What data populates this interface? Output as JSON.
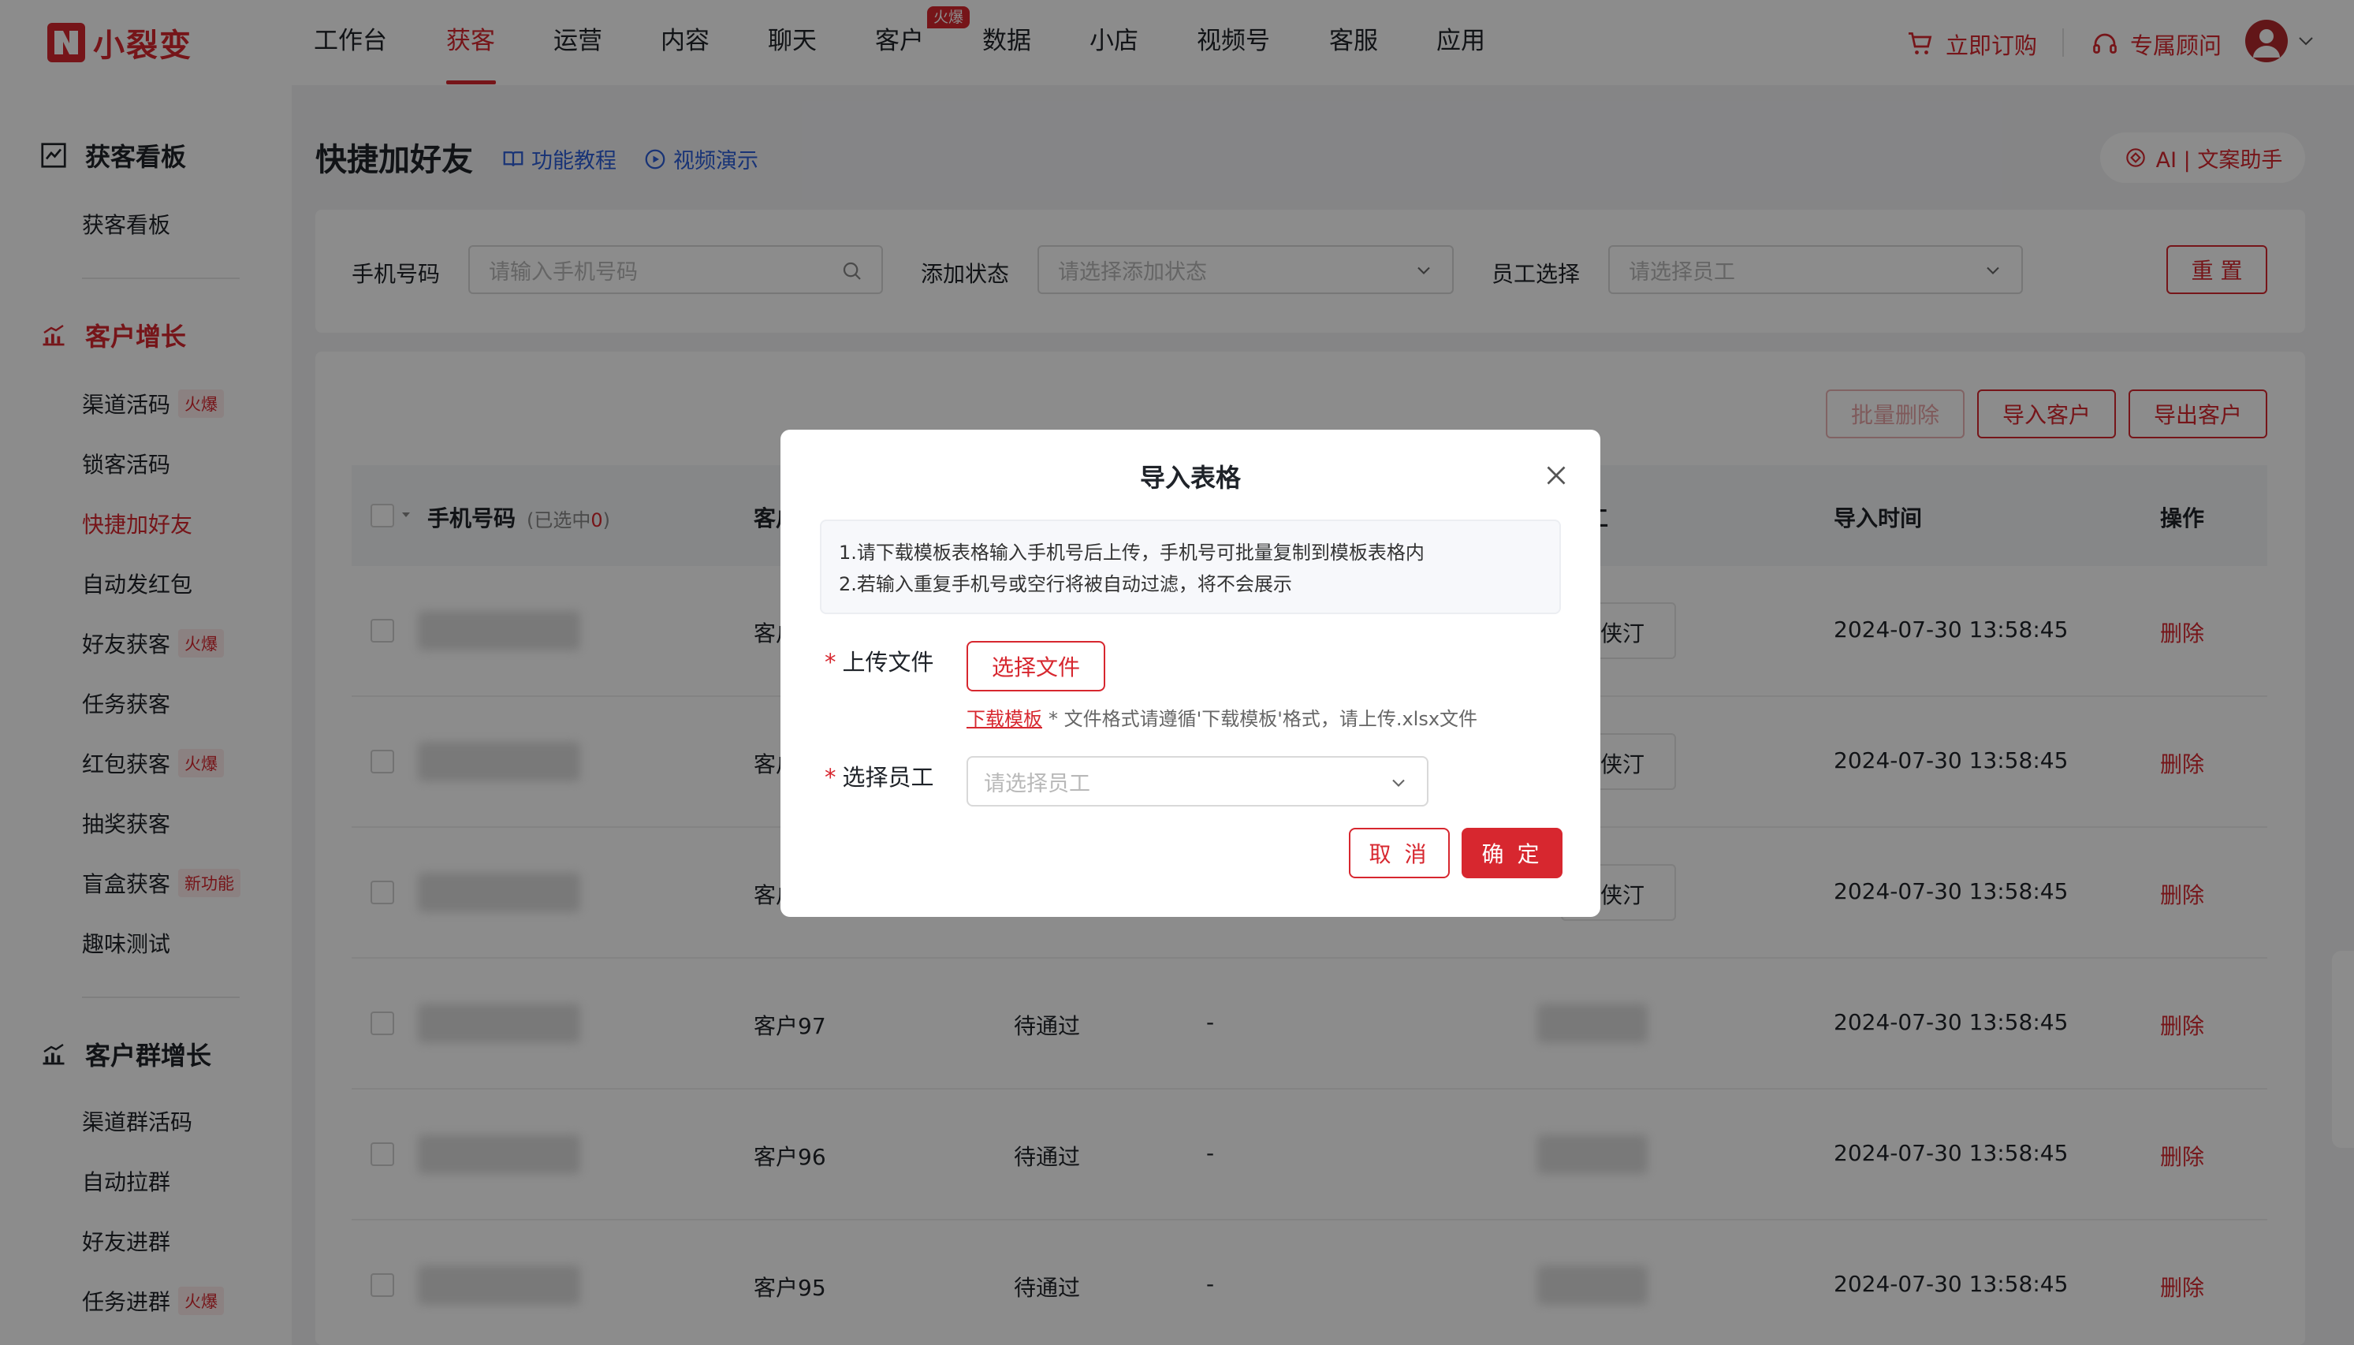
{
  "brand": {
    "name": "小裂变",
    "color": "#d7272f"
  },
  "nav": {
    "items": [
      "工作台",
      "获客",
      "运营",
      "内容",
      "聊天",
      "客户",
      "数据",
      "小店",
      "视频号",
      "客服",
      "应用"
    ],
    "active": "获客",
    "hot_badge": "火爆",
    "order_label": "立即订购",
    "advisor_label": "专属顾问"
  },
  "sidebar": {
    "sections": [
      {
        "title": "获客看板",
        "items": [
          "获客看板"
        ]
      },
      {
        "title": "客户增长",
        "items": [
          "渠道活码",
          "锁客活码",
          "快捷加好友",
          "自动发红包",
          "好友获客",
          "任务获客",
          "红包获客",
          "抽奖获客",
          "盲盒获客",
          "趣味测试"
        ]
      },
      {
        "title": "客户群增长",
        "items": [
          "渠道群活码",
          "自动拉群",
          "好友进群",
          "任务进群"
        ]
      }
    ],
    "tags": {
      "hot": "火爆",
      "new": "新功能"
    },
    "active_item": "快捷加好友"
  },
  "page": {
    "title": "快捷加好友",
    "tutorial_link": "功能教程",
    "video_link": "视频演示",
    "ai_button": "AI | 文案助手"
  },
  "filters": {
    "phone_label": "手机号码",
    "phone_placeholder": "请输入手机号码",
    "status_label": "添加状态",
    "status_placeholder": "请选择添加状态",
    "staff_label": "员工选择",
    "staff_placeholder": "请选择员工",
    "reset_button": "重 置"
  },
  "toolbar": {
    "batch_delete": "批量删除",
    "import": "导入客户",
    "export": "导出客户"
  },
  "table": {
    "headers": {
      "phone": "手机号码",
      "selected_prefix": "(已选中",
      "selected_count": "0",
      "selected_suffix": ")",
      "customer": "客户",
      "staff_tail": "工",
      "import_time": "导入时间",
      "action": "操作"
    },
    "rows": [
      {
        "customer": "客户",
        "status": "",
        "extra": "",
        "staff": "侠汀",
        "time": "2024-07-30 13:58:45",
        "action": "删除"
      },
      {
        "customer": "客户",
        "status": "",
        "extra": "",
        "staff": "侠汀",
        "time": "2024-07-30 13:58:45",
        "action": "删除"
      },
      {
        "customer": "客户",
        "status": "",
        "extra": "",
        "staff": "侠汀",
        "time": "2024-07-30 13:58:45",
        "action": "删除"
      },
      {
        "customer": "客户97",
        "status": "待通过",
        "extra": "-",
        "staff": "",
        "time": "2024-07-30 13:58:45",
        "action": "删除"
      },
      {
        "customer": "客户96",
        "status": "待通过",
        "extra": "-",
        "staff": "",
        "time": "2024-07-30 13:58:45",
        "action": "删除"
      },
      {
        "customer": "客户95",
        "status": "待通过",
        "extra": "-",
        "staff": "",
        "time": "2024-07-30 13:58:45",
        "action": "删除"
      }
    ]
  },
  "modal": {
    "title": "导入表格",
    "tip_line1": "1.请下载模板表格输入手机号后上传，手机号可批量复制到模板表格内",
    "tip_line2": "2.若输入重复手机号或空行将被自动过滤，将不会展示",
    "upload_label": "上传文件",
    "file_button": "选择文件",
    "template_link": "下载模板",
    "file_hint": "* 文件格式请遵循'下载模板'格式，请上传.xlsx文件",
    "staff_label": "选择员工",
    "staff_placeholder": "请选择员工",
    "cancel": "取 消",
    "confirm": "确 定"
  }
}
